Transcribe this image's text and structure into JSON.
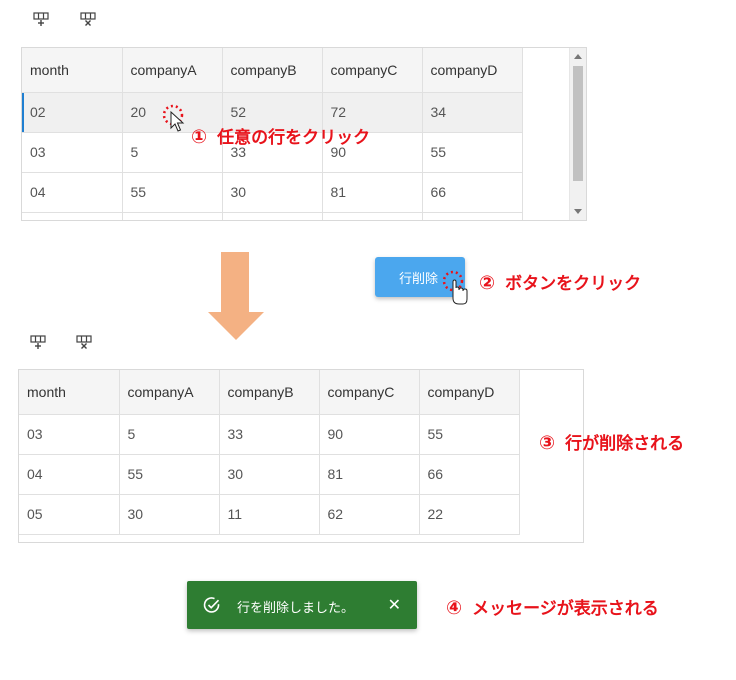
{
  "table": {
    "headers": [
      "month",
      "companyA",
      "companyB",
      "companyC",
      "companyD"
    ]
  },
  "before": {
    "rows": [
      [
        "02",
        "20",
        "52",
        "72",
        "34"
      ],
      [
        "03",
        "5",
        "33",
        "90",
        "55"
      ],
      [
        "04",
        "55",
        "30",
        "81",
        "66"
      ]
    ]
  },
  "after": {
    "rows": [
      [
        "03",
        "5",
        "33",
        "90",
        "55"
      ],
      [
        "04",
        "55",
        "30",
        "81",
        "66"
      ],
      [
        "05",
        "30",
        "11",
        "62",
        "22"
      ]
    ]
  },
  "delete_button": {
    "label": "行削除"
  },
  "toast": {
    "message": "行を削除しました。",
    "close": "✕"
  },
  "annotations": {
    "step1": {
      "num": "①",
      "text": "任意の行をクリック"
    },
    "step2": {
      "num": "②",
      "text": "ボタンをクリック"
    },
    "step3": {
      "num": "③",
      "text": "行が削除される"
    },
    "step4": {
      "num": "④",
      "text": "メッセージが表示される"
    }
  },
  "icons": {
    "add_row": "add-row-icon",
    "delete_row": "delete-row-icon"
  },
  "colors": {
    "annotation": "#e8131b",
    "button": "#4ba7ee",
    "toast": "#2e7d32",
    "arrow": "#f4b183",
    "selection": "#1f7fd1"
  }
}
